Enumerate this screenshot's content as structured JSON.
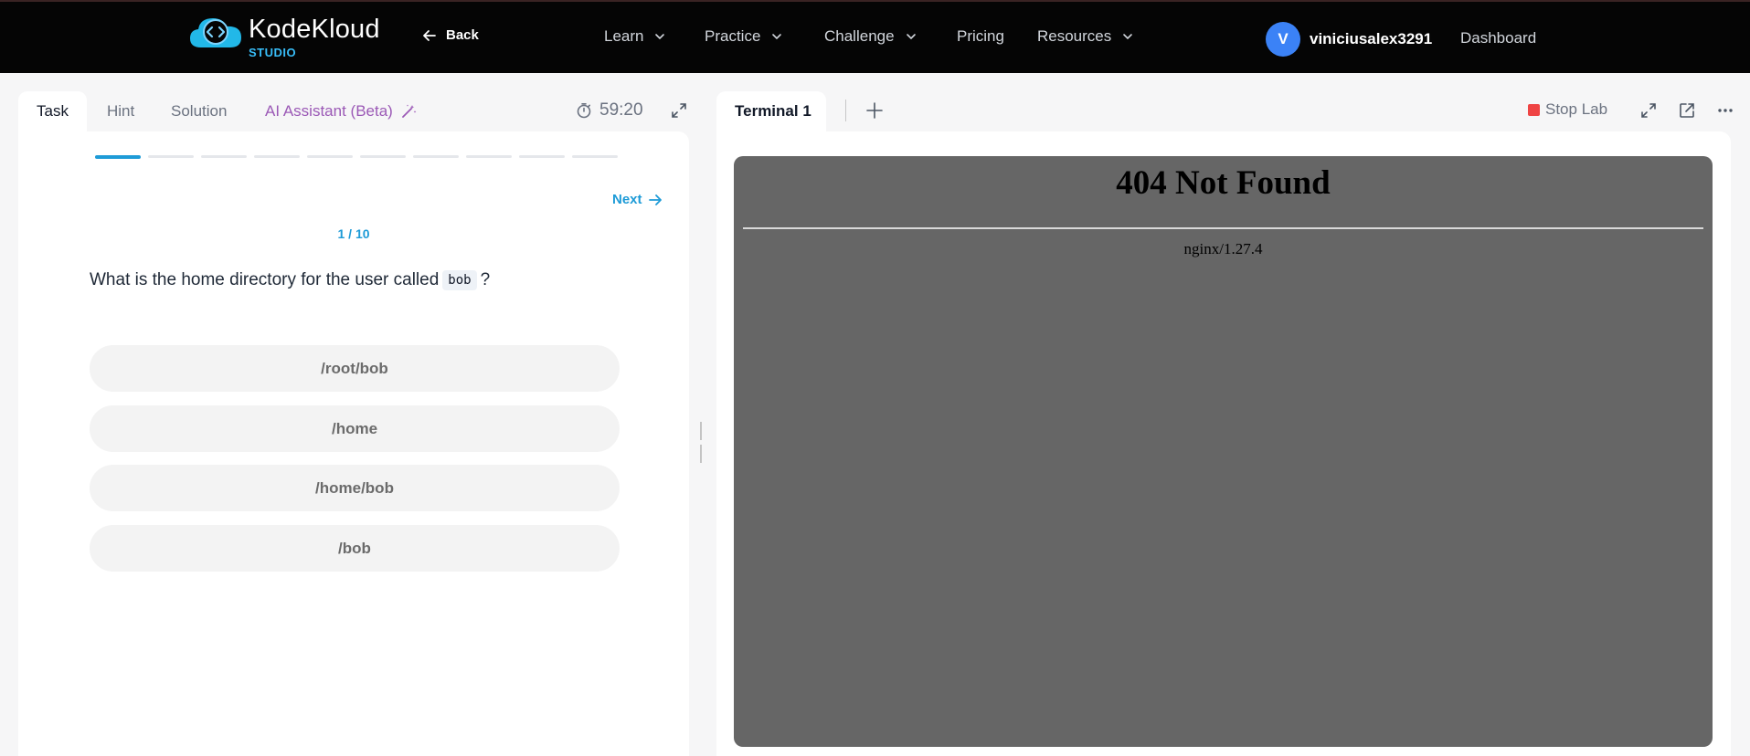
{
  "nav": {
    "logo_name": "KodeKloud",
    "logo_sub": "STUDIO",
    "back_label": "Back",
    "items": [
      {
        "label": "Learn"
      },
      {
        "label": "Practice"
      },
      {
        "label": "Challenge"
      },
      {
        "label": "Pricing"
      },
      {
        "label": "Resources"
      }
    ],
    "avatar_initial": "V",
    "username": "viniciusalex3291",
    "dashboard_label": "Dashboard"
  },
  "task_panel": {
    "tabs": [
      {
        "label": "Task",
        "active": true
      },
      {
        "label": "Hint"
      },
      {
        "label": "Solution"
      },
      {
        "label": "AI Assistant (Beta)"
      }
    ],
    "timer": "59:20",
    "progress": {
      "current": 1,
      "total": 10
    },
    "next_label": "Next",
    "counter": "1 / 10",
    "question_prefix": "What is the home directory for the user called",
    "question_code": "bob",
    "question_suffix": "?",
    "options": [
      "/root/bob",
      "/home",
      "/home/bob",
      "/bob"
    ]
  },
  "terminal_panel": {
    "tab_label": "Terminal 1",
    "stop_lab_label": "Stop Lab",
    "page_title": "404 Not Found",
    "page_server": "nginx/1.27.4"
  },
  "colors": {
    "accent": "#1e9bd7",
    "ai_purple": "#9b59b6",
    "stop_red": "#ef4444",
    "avatar_blue": "#3b82f6",
    "terminal_bg": "#666666"
  }
}
